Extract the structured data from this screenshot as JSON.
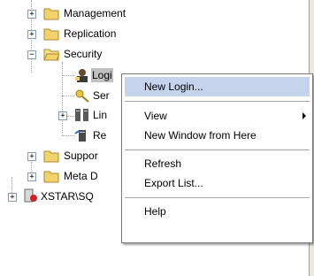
{
  "tree": {
    "items": [
      {
        "label": "Management",
        "icon": "folder-icon"
      },
      {
        "label": "Replication",
        "icon": "folder-icon"
      },
      {
        "label": "Security",
        "icon": "folder-open-icon"
      },
      {
        "label": "Logi",
        "icon": "logins-icon"
      },
      {
        "label": "Ser",
        "icon": "server-roles-icon"
      },
      {
        "label": "Lin",
        "icon": "linked-servers-icon"
      },
      {
        "label": "Re",
        "icon": "remote-servers-icon"
      },
      {
        "label": "Suppor",
        "icon": "folder-icon"
      },
      {
        "label": "Meta D",
        "icon": "folder-icon"
      },
      {
        "label": "XSTAR\\SQ",
        "icon": "server-stopped-icon"
      }
    ],
    "expander_plus": "+",
    "expander_minus": "−"
  },
  "context_menu": {
    "new_login": "New Login...",
    "view": "View",
    "new_window": "New Window from Here",
    "refresh": "Refresh",
    "export_list": "Export List...",
    "help": "Help"
  },
  "colors": {
    "highlight": "#c5d3ec",
    "folder": "#f2d26b",
    "menu_border": "#7a7a7a"
  }
}
